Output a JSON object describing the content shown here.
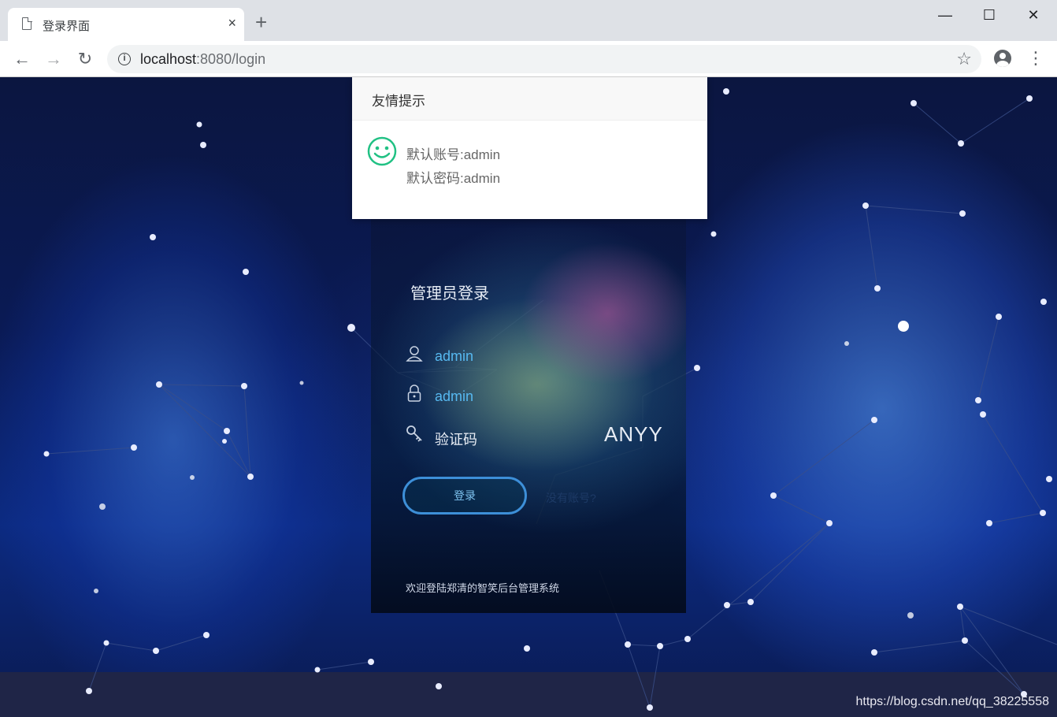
{
  "browser": {
    "tab_title": "登录界面",
    "tab_close": "×",
    "new_tab": "+",
    "url_host": "localhost",
    "url_rest": ":8080/login",
    "minimize": "—",
    "maximize": "☐",
    "close": "✕",
    "back": "←",
    "forward": "→",
    "reload": "↻",
    "star": "☆",
    "menu": "⋮"
  },
  "dialog": {
    "title": "友情提示",
    "line1": "默认账号:admin",
    "line2": "默认密码:admin",
    "icon": "smile-icon"
  },
  "login": {
    "title": "管理员登录",
    "username_value": "admin",
    "password_value": "admin",
    "captcha_label": "验证码",
    "captcha_code": "ANYY",
    "login_button": "登录",
    "register_link": "没有账号?",
    "welcome": "欢迎登陆郑清的智笑后台管理系统"
  },
  "watermark": "https://blog.csdn.net/qq_38225558",
  "colors": {
    "accent": "#56b8f0",
    "button_border": "#3d8fd8",
    "smile": "#21c184"
  }
}
